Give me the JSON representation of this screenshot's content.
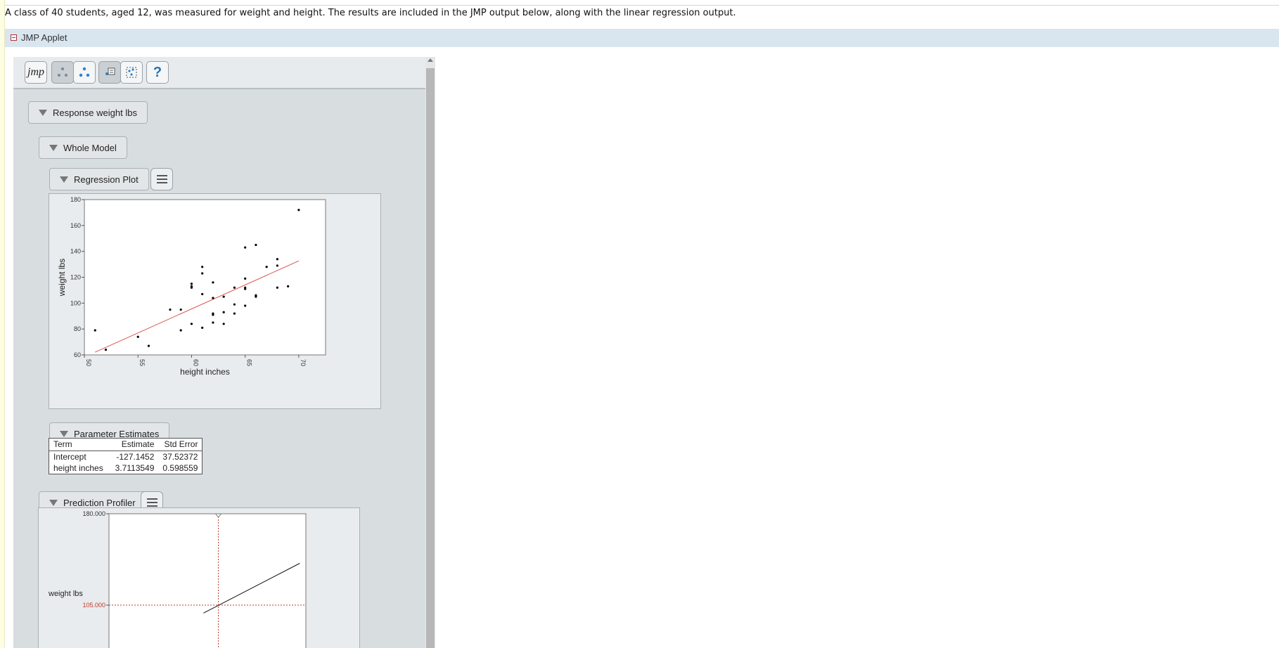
{
  "intro_text": "A class of 40 students, aged 12, was measured for weight and height. The results are included in the JMP output below, along with the linear regression output.",
  "applet": {
    "title": "JMP Applet",
    "toolbar": {
      "buttons": [
        {
          "name": "jmp-logo-button",
          "label": "jmp"
        },
        {
          "name": "points-gray-icon"
        },
        {
          "name": "points-blue-icon"
        },
        {
          "name": "report-icon"
        },
        {
          "name": "grid-select-icon"
        },
        {
          "name": "help-icon",
          "label": "?"
        }
      ]
    },
    "outlines": {
      "response": "Response weight lbs",
      "whole_model": "Whole Model",
      "regression_plot": "Regression Plot",
      "parameter_estimates": "Parameter Estimates",
      "prediction_profiler": "Prediction Profiler"
    },
    "colors": {
      "fit_line": "#d9534f",
      "points": "#000000",
      "profiler_ref": "#c0392b"
    }
  },
  "chart_data": [
    {
      "type": "scatter",
      "title": "",
      "xlabel": "height inches",
      "ylabel": "weight lbs",
      "xlim": [
        50,
        72.5
      ],
      "ylim": [
        60,
        180
      ],
      "xticks": [
        50,
        55,
        60,
        65,
        70
      ],
      "yticks": [
        60,
        80,
        100,
        120,
        140,
        160,
        180
      ],
      "grid": false,
      "points": [
        [
          51,
          79
        ],
        [
          52,
          64
        ],
        [
          55,
          74
        ],
        [
          56,
          67
        ],
        [
          58,
          95
        ],
        [
          59,
          95
        ],
        [
          59,
          79
        ],
        [
          60,
          115
        ],
        [
          60,
          112
        ],
        [
          60,
          84
        ],
        [
          61,
          128
        ],
        [
          61,
          123
        ],
        [
          61,
          107
        ],
        [
          61,
          81
        ],
        [
          62,
          116
        ],
        [
          62,
          104
        ],
        [
          62,
          92
        ],
        [
          62,
          91
        ],
        [
          62,
          85
        ],
        [
          63,
          105
        ],
        [
          63,
          93
        ],
        [
          63,
          84
        ],
        [
          64,
          112
        ],
        [
          64,
          99
        ],
        [
          64,
          92
        ],
        [
          65,
          143
        ],
        [
          65,
          119
        ],
        [
          65,
          112
        ],
        [
          65,
          111
        ],
        [
          65,
          98
        ],
        [
          66,
          145
        ],
        [
          66,
          106
        ],
        [
          66,
          105
        ],
        [
          67,
          128
        ],
        [
          68,
          134
        ],
        [
          68,
          129
        ],
        [
          68,
          112
        ],
        [
          69,
          113
        ],
        [
          70,
          172
        ],
        [
          60,
          113
        ]
      ],
      "fit_line": {
        "intercept": -127.1452,
        "slope": 3.7113549,
        "x_range": [
          51,
          70
        ]
      }
    },
    {
      "type": "table",
      "columns": [
        "Term",
        "Estimate",
        "Std Error"
      ],
      "rows": [
        [
          "Intercept",
          "-127.1452",
          "37.52372"
        ],
        [
          "height inches",
          "3.7113549",
          "0.598559"
        ]
      ]
    },
    {
      "type": "line",
      "ylabel": "weight lbs",
      "yticks_visible": [
        {
          "label": "180.000",
          "value": 180
        },
        {
          "label": "105.000",
          "value": 105
        }
      ],
      "current_y": 105,
      "current_y_label": "105.000",
      "ylim": [
        105,
        180
      ],
      "xlim": [
        50,
        72.5
      ],
      "current_x": 62.5,
      "fit_line": {
        "intercept": -127.1452,
        "slope": 3.7113549
      }
    }
  ]
}
